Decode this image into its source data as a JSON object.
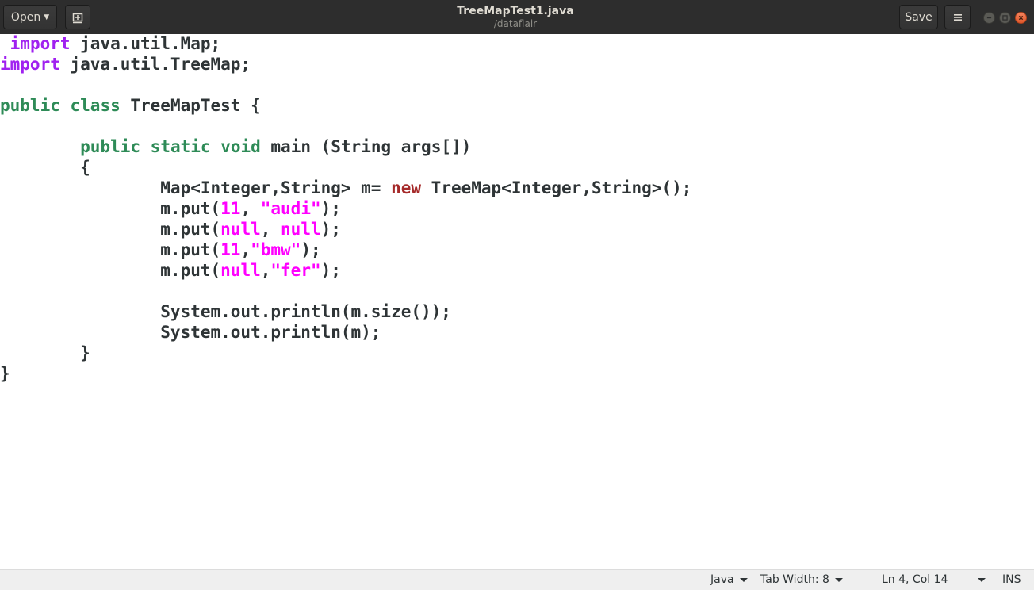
{
  "window": {
    "title": "TreeMapTest1.java",
    "subtitle": "/dataflair"
  },
  "header": {
    "open_label": "Open",
    "save_label": "Save"
  },
  "editor": {
    "lines": [
      [
        {
          "t": " "
        },
        {
          "t": "import",
          "c": "kw-purple"
        },
        {
          "t": " java.util.Map;"
        }
      ],
      [
        {
          "t": "import",
          "c": "kw-purple"
        },
        {
          "t": " java.util.TreeMap;"
        }
      ],
      [],
      [
        {
          "t": "public",
          "c": "kw-green"
        },
        {
          "t": " "
        },
        {
          "t": "class",
          "c": "kw-green"
        },
        {
          "t": " TreeMapTest {"
        }
      ],
      [],
      [
        {
          "t": "        "
        },
        {
          "t": "public",
          "c": "kw-green"
        },
        {
          "t": " "
        },
        {
          "t": "static",
          "c": "kw-green"
        },
        {
          "t": " "
        },
        {
          "t": "void",
          "c": "kw-green"
        },
        {
          "t": " main (String args[])"
        }
      ],
      [
        {
          "t": "        {"
        }
      ],
      [
        {
          "t": "                Map<Integer,String> m= "
        },
        {
          "t": "new",
          "c": "kw-red"
        },
        {
          "t": " TreeMap<Integer,String>();"
        }
      ],
      [
        {
          "t": "                m.put("
        },
        {
          "t": "11",
          "c": "lit"
        },
        {
          "t": ", "
        },
        {
          "t": "\"audi\"",
          "c": "lit"
        },
        {
          "t": ");"
        }
      ],
      [
        {
          "t": "                m.put("
        },
        {
          "t": "null",
          "c": "lit"
        },
        {
          "t": ", "
        },
        {
          "t": "null",
          "c": "lit"
        },
        {
          "t": ");"
        }
      ],
      [
        {
          "t": "                m.put("
        },
        {
          "t": "11",
          "c": "lit"
        },
        {
          "t": ","
        },
        {
          "t": "\"bmw\"",
          "c": "lit"
        },
        {
          "t": ");"
        }
      ],
      [
        {
          "t": "                m.put("
        },
        {
          "t": "null",
          "c": "lit"
        },
        {
          "t": ","
        },
        {
          "t": "\"fer\"",
          "c": "lit"
        },
        {
          "t": ");"
        }
      ],
      [],
      [
        {
          "t": "                System.out.println(m.size());"
        }
      ],
      [
        {
          "t": "                System.out.println(m);"
        }
      ],
      [
        {
          "t": "        }"
        }
      ],
      [
        {
          "t": "}"
        }
      ]
    ]
  },
  "statusbar": {
    "language": "Java",
    "tab_width": "Tab Width: 8",
    "position": "Ln 4, Col 14",
    "mode": "INS"
  },
  "colors": {
    "keyword_import": "#a020f0",
    "keyword_type": "#2e8b57",
    "keyword_new": "#a52a2a",
    "literal": "#ff00ff",
    "headerbar": "#2d2d2d",
    "close_button": "#e95420"
  }
}
